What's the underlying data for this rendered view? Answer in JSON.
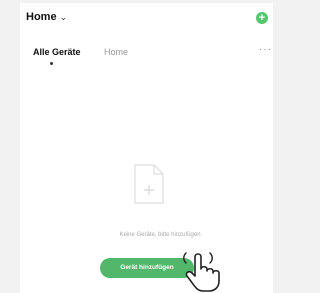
{
  "header": {
    "home_label": "Home",
    "chevron": "⌄",
    "add_icon_glyph": "+"
  },
  "tabs": {
    "active_label": "Alle Geräte",
    "second_label": "Home",
    "more_glyph": "···"
  },
  "empty_state": {
    "icon": "document-plus-icon",
    "message": "Keine Geräte, bitte hinzufügen",
    "button_label": "Gerät hinzufügen"
  },
  "overlay": {
    "icon": "pointing-hand-icon"
  },
  "colors": {
    "accent": "#52b66b",
    "header_add": "#52c86e"
  }
}
